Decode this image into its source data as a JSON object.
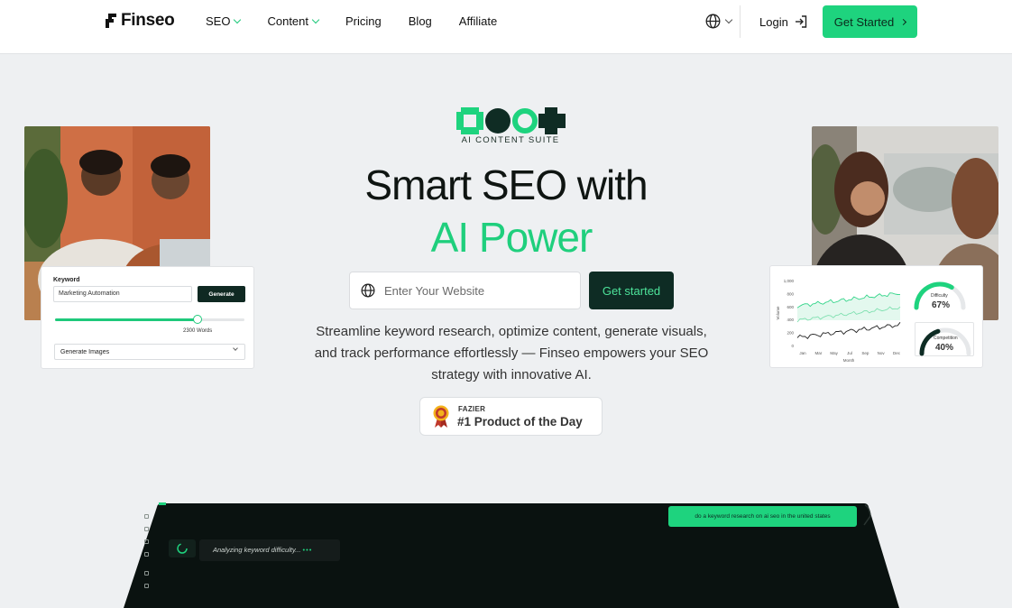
{
  "nav": {
    "brand": "Finseo",
    "links": [
      {
        "label": "SEO",
        "has_dropdown": true
      },
      {
        "label": "Content",
        "has_dropdown": true
      },
      {
        "label": "Pricing",
        "has_dropdown": false
      },
      {
        "label": "Blog",
        "has_dropdown": false
      },
      {
        "label": "Affiliate",
        "has_dropdown": false
      }
    ],
    "language_icon": "globe-icon",
    "login_label": "Login",
    "cta_label": "Get Started"
  },
  "hero": {
    "suite_label": "AI CONTENT SUITE",
    "title_line1": "Smart SEO with",
    "title_line2": "AI Power",
    "search_placeholder": "Enter Your Website",
    "cta_label": "Get started",
    "description": "Streamline keyword research, optimize content, generate visuals, and track performance effortlessly — Finseo empowers your SEO strategy with innovative AI.",
    "badge_small": "FAZIER",
    "badge_big": "#1 Product of the Day"
  },
  "keyword_card": {
    "label": "Keyword",
    "value": "Marketing Automation",
    "button": "Generate",
    "slider_fraction": 0.75,
    "words_label": "2300 Words",
    "select_value": "Generate Images"
  },
  "metrics_card": {
    "ylabel": "Volume",
    "xlabel": "Month",
    "y_ticks": [
      "1,000",
      "800",
      "600",
      "400",
      "200",
      "0"
    ],
    "x_ticks": [
      "Jan",
      "Mar",
      "May",
      "Jul",
      "Sep",
      "Nov",
      "Dec"
    ],
    "difficulty_label": "Difficulty",
    "difficulty_value": "67%",
    "difficulty_fraction": 0.67,
    "competition_label": "Competition",
    "competition_value": "40%",
    "competition_fraction": 0.4
  },
  "app_preview": {
    "user_message": "do a keyword research on ai seo in the united states",
    "status": "Analyzing keyword difficulty...",
    "status_dots": "•••"
  },
  "colors": {
    "accent": "#1ed37e",
    "dark": "#0e2c24",
    "background": "#eef0f2"
  }
}
